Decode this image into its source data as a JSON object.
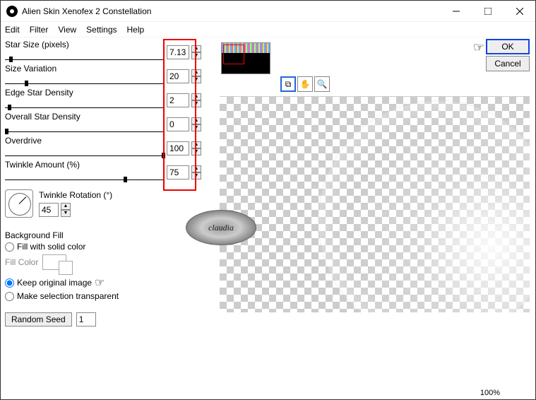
{
  "window": {
    "title": "Alien Skin Xenofex 2 Constellation"
  },
  "menu": [
    "Edit",
    "Filter",
    "View",
    "Settings",
    "Help"
  ],
  "params": [
    {
      "label": "Star Size (pixels)",
      "value": "7.13",
      "thumb": 6
    },
    {
      "label": "Size Variation",
      "value": "20",
      "thumb": 28
    },
    {
      "label": "Edge Star Density",
      "value": "2",
      "thumb": 4
    },
    {
      "label": "Overall Star Density",
      "value": "0",
      "thumb": 0
    },
    {
      "label": "Overdrive",
      "value": "100",
      "thumb": 222
    },
    {
      "label": "Twinkle Amount (%)",
      "value": "75",
      "thumb": 168
    }
  ],
  "twinkle_rotation": {
    "label": "Twinkle Rotation (°)",
    "value": "45"
  },
  "bgfill": {
    "legend": "Background Fill",
    "opt1": "Fill with solid color",
    "fillcolor_label": "Fill Color",
    "opt2": "Keep original image",
    "opt3": "Make selection transparent",
    "selected": "opt2"
  },
  "random": {
    "button": "Random Seed",
    "value": "1"
  },
  "buttons": {
    "ok": "OK",
    "cancel": "Cancel"
  },
  "status": {
    "zoom": "100%"
  },
  "watermark": "claudia"
}
